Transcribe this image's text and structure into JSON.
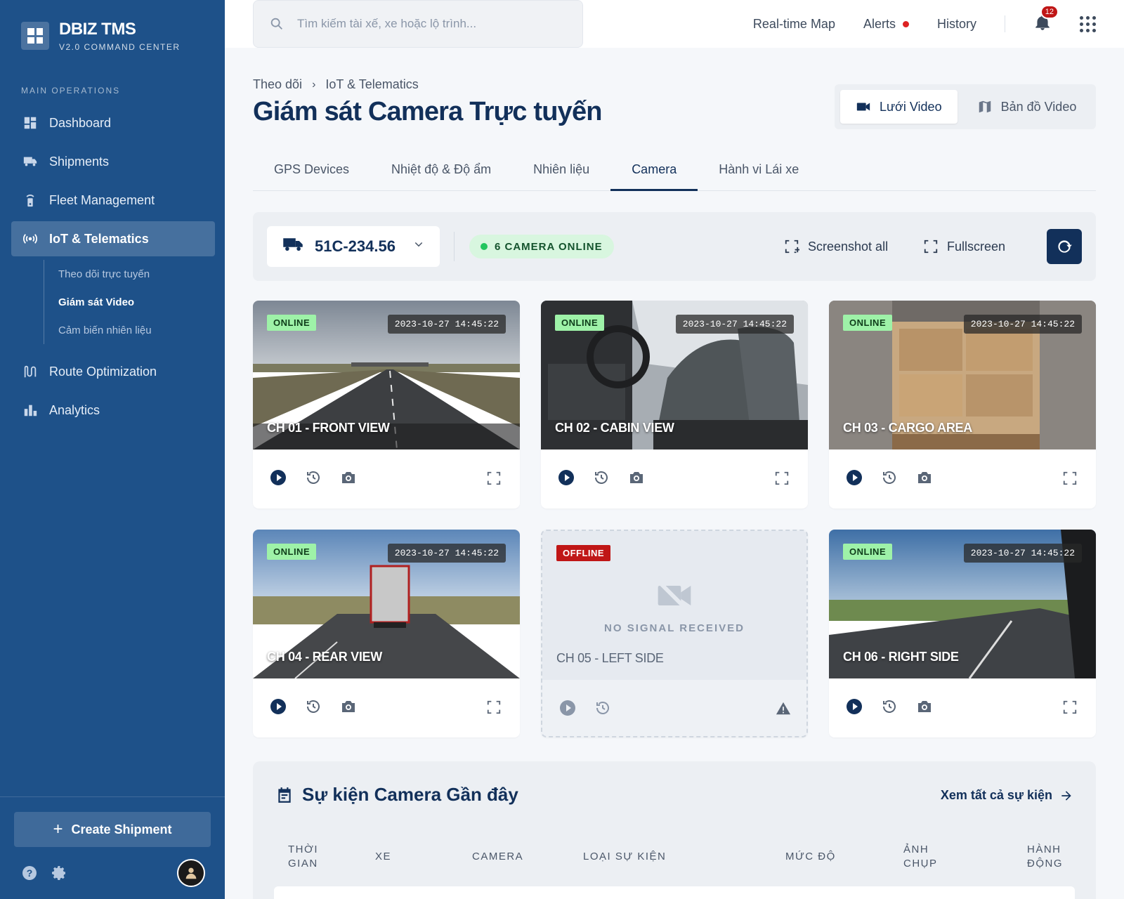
{
  "brand": {
    "name": "DBIZ TMS",
    "subtitle": "V2.0 COMMAND CENTER"
  },
  "sidebar": {
    "section_label": "MAIN OPERATIONS",
    "items": [
      {
        "label": "Dashboard",
        "icon": "dashboard-icon"
      },
      {
        "label": "Shipments",
        "icon": "truck-icon"
      },
      {
        "label": "Fleet Management",
        "icon": "tracker-icon"
      },
      {
        "label": "IoT & Telematics",
        "icon": "signal-icon",
        "active": true
      },
      {
        "label": "Route Optimization",
        "icon": "route-icon"
      },
      {
        "label": "Analytics",
        "icon": "bar-chart-icon"
      }
    ],
    "subitems": [
      {
        "label": "Theo dõi trực tuyến"
      },
      {
        "label": "Giám sát Video",
        "active": true
      },
      {
        "label": "Cảm biến nhiên liệu"
      }
    ],
    "create_button": "Create Shipment"
  },
  "header": {
    "search_placeholder": "Tìm kiếm tài xế, xe hoặc lộ trình...",
    "links": {
      "map": "Real-time Map",
      "alerts": "Alerts",
      "history": "History"
    },
    "notification_count": "12"
  },
  "breadcrumb": {
    "parent": "Theo dõi",
    "current": "IoT & Telematics"
  },
  "page_title": "Giám sát Camera Trực tuyến",
  "view_toggle": {
    "grid": "Lưới Video",
    "map": "Bản đồ Video"
  },
  "tabs": [
    "GPS Devices",
    "Nhiệt độ & Độ ẩm",
    "Nhiên liệu",
    "Camera",
    "Hành vi Lái xe"
  ],
  "active_tab": "Camera",
  "toolbar": {
    "vehicle": "51C-234.56",
    "online_status": "6 CAMERA ONLINE",
    "screenshot_all": "Screenshot all",
    "fullscreen": "Fullscreen"
  },
  "cameras": [
    {
      "status": "ONLINE",
      "timestamp": "2023-10-27 14:45:22",
      "label": "CH 01 - FRONT VIEW"
    },
    {
      "status": "ONLINE",
      "timestamp": "2023-10-27 14:45:22",
      "label": "CH 02 - CABIN VIEW"
    },
    {
      "status": "ONLINE",
      "timestamp": "2023-10-27 14:45:22",
      "label": "CH 03 - CARGO AREA"
    },
    {
      "status": "ONLINE",
      "timestamp": "2023-10-27 14:45:22",
      "label": "CH 04 - REAR VIEW"
    },
    {
      "status": "OFFLINE",
      "no_signal": "NO SIGNAL RECEIVED",
      "label": "CH 05 - LEFT SIDE"
    },
    {
      "status": "ONLINE",
      "timestamp": "2023-10-27 14:45:22",
      "label": "CH 06 - RIGHT SIDE"
    }
  ],
  "events": {
    "title": "Sự kiện Camera Gần đây",
    "view_all": "Xem tất cả sự kiện",
    "columns": [
      "THỜI GIAN",
      "XE",
      "CAMERA",
      "LOẠI SỰ KIỆN",
      "MỨC ĐỘ",
      "ẢNH CHỤP",
      "HÀNH ĐỘNG"
    ]
  },
  "colors": {
    "sidebar": "#1e5189",
    "primary": "#12305a",
    "online": "#9ef2a8",
    "offline": "#c01616"
  }
}
